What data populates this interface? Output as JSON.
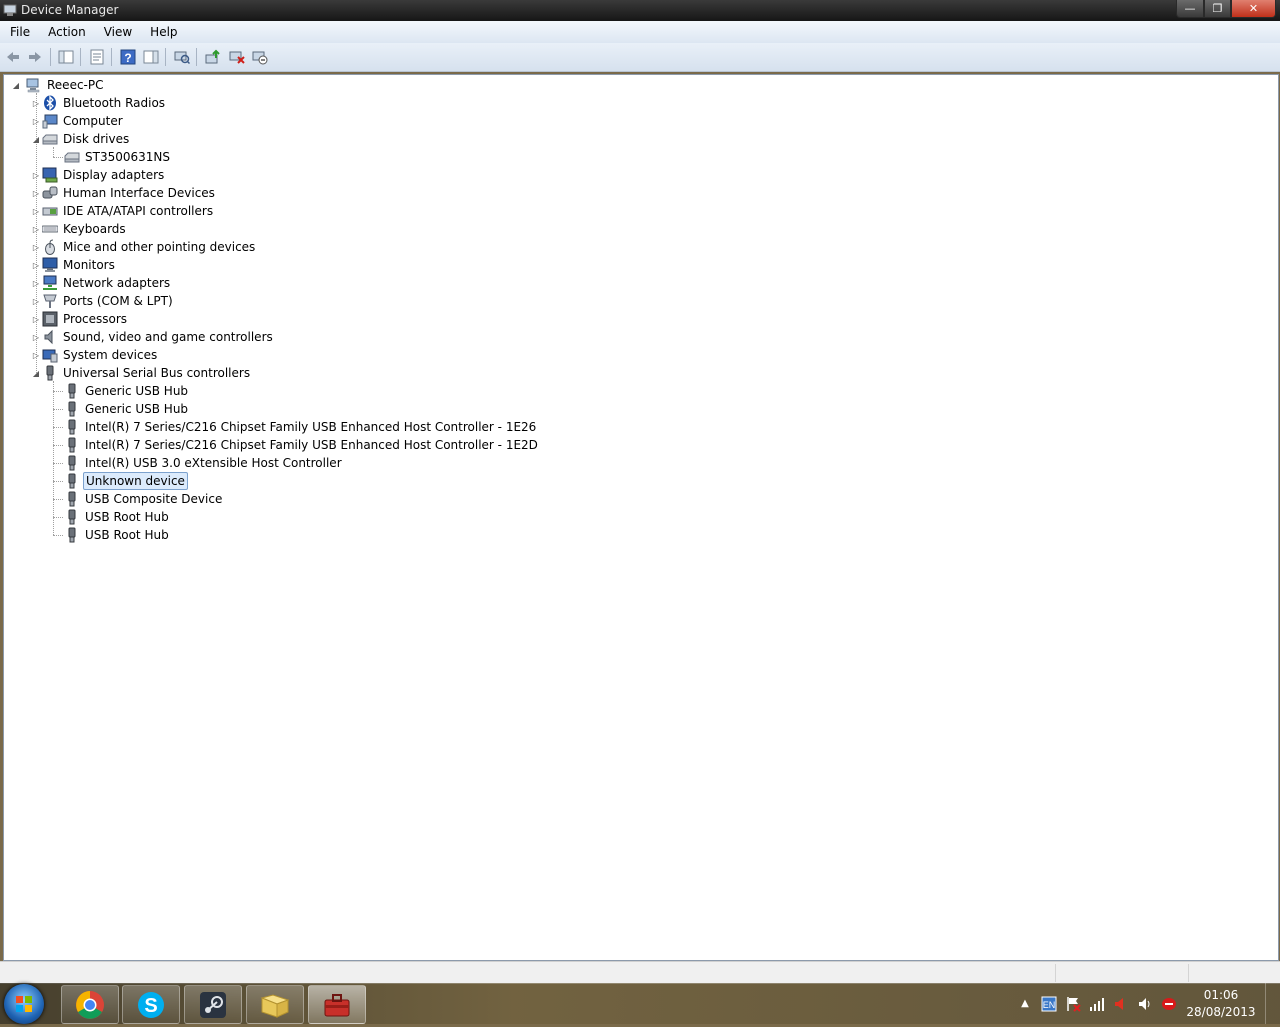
{
  "window": {
    "title": "Device Manager"
  },
  "menu": [
    {
      "label": "File"
    },
    {
      "label": "Action"
    },
    {
      "label": "View"
    },
    {
      "label": "Help"
    }
  ],
  "toolbar": [
    {
      "icon": "back-arrow-icon"
    },
    {
      "icon": "forward-arrow-icon"
    },
    {
      "icon": "show-hide-console-tree-icon"
    },
    {
      "icon": "properties-icon"
    },
    {
      "icon": "help-icon"
    },
    {
      "icon": "show-hide-action-pane-icon"
    },
    {
      "icon": "scan-hardware-changes-icon"
    },
    {
      "icon": "update-driver-icon"
    },
    {
      "icon": "uninstall-icon"
    },
    {
      "icon": "disable-device-icon"
    }
  ],
  "tree": {
    "root": {
      "label": "Reeec-PC",
      "icon": "computer-icon"
    },
    "items": [
      {
        "label": "Bluetooth Radios",
        "icon": "bluetooth-icon",
        "expanded": false,
        "level": 1
      },
      {
        "label": "Computer",
        "icon": "computer-icon",
        "expanded": false,
        "level": 1
      },
      {
        "label": "Disk drives",
        "icon": "disk-drive-icon",
        "expanded": true,
        "level": 1
      },
      {
        "label": "ST3500631NS",
        "icon": "disk-drive-icon",
        "level": 2
      },
      {
        "label": "Display adapters",
        "icon": "display-adapter-icon",
        "expanded": false,
        "level": 1
      },
      {
        "label": "Human Interface Devices",
        "icon": "hid-icon",
        "expanded": false,
        "level": 1
      },
      {
        "label": "IDE ATA/ATAPI controllers",
        "icon": "ide-controller-icon",
        "expanded": false,
        "level": 1
      },
      {
        "label": "Keyboards",
        "icon": "keyboard-icon",
        "expanded": false,
        "level": 1
      },
      {
        "label": "Mice and other pointing devices",
        "icon": "mouse-icon",
        "expanded": false,
        "level": 1
      },
      {
        "label": "Monitors",
        "icon": "monitor-icon",
        "expanded": false,
        "level": 1
      },
      {
        "label": "Network adapters",
        "icon": "network-adapter-icon",
        "expanded": false,
        "level": 1
      },
      {
        "label": "Ports (COM & LPT)",
        "icon": "port-icon",
        "expanded": false,
        "level": 1
      },
      {
        "label": "Processors",
        "icon": "processor-icon",
        "expanded": false,
        "level": 1
      },
      {
        "label": "Sound, video and game controllers",
        "icon": "speaker-icon",
        "expanded": false,
        "level": 1
      },
      {
        "label": "System devices",
        "icon": "system-device-icon",
        "expanded": false,
        "level": 1
      },
      {
        "label": "Universal Serial Bus controllers",
        "icon": "usb-plug-icon",
        "expanded": true,
        "level": 1
      },
      {
        "label": "Generic USB Hub",
        "icon": "usb-plug-icon",
        "level": 2
      },
      {
        "label": "Generic USB Hub",
        "icon": "usb-plug-icon",
        "level": 2
      },
      {
        "label": "Intel(R) 7 Series/C216 Chipset Family USB Enhanced Host Controller - 1E26",
        "icon": "usb-plug-icon",
        "level": 2
      },
      {
        "label": "Intel(R) 7 Series/C216 Chipset Family USB Enhanced Host Controller - 1E2D",
        "icon": "usb-plug-icon",
        "level": 2
      },
      {
        "label": "Intel(R) USB 3.0 eXtensible Host Controller",
        "icon": "usb-plug-icon",
        "level": 2
      },
      {
        "label": "Unknown device",
        "icon": "usb-plug-icon",
        "level": 2,
        "selected": true
      },
      {
        "label": "USB Composite Device",
        "icon": "usb-plug-icon",
        "level": 2
      },
      {
        "label": "USB Root Hub",
        "icon": "usb-plug-icon",
        "level": 2
      },
      {
        "label": "USB Root Hub",
        "icon": "usb-plug-icon",
        "level": 2
      }
    ]
  },
  "taskbar": {
    "apps": [
      {
        "icon": "chrome-icon"
      },
      {
        "icon": "skype-icon"
      },
      {
        "icon": "steam-icon"
      },
      {
        "icon": "file-explorer-icon"
      },
      {
        "icon": "device-manager-icon",
        "active": true
      }
    ],
    "clock": {
      "time": "01:06",
      "date": "28/08/2013"
    }
  },
  "colors": {
    "selection_bg": "#dcebfc",
    "selection_border": "#7da2ce",
    "titlebar": "#1e1e1e"
  }
}
